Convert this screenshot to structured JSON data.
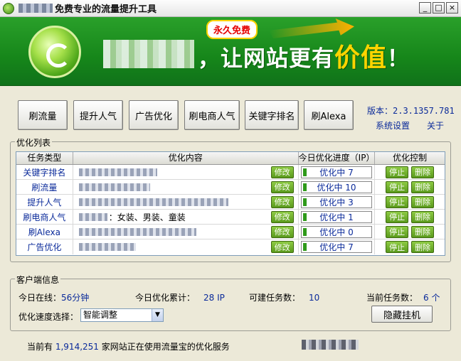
{
  "window": {
    "title": "免费专业的流量提升工具",
    "controls": {
      "minimize": "_",
      "maximize": "□",
      "close": "×"
    }
  },
  "banner": {
    "badge": "永久免费",
    "slogan_main": "，让网站更有",
    "slogan_accent": "价值",
    "slogan_end": "！"
  },
  "toolbar": {
    "buttons": [
      "刷流量",
      "提升人气",
      "广告优化",
      "刷电商人气",
      "关键字排名",
      "刷Alexa"
    ],
    "version": "版本：2.3.1357.781",
    "settings": "系统设置",
    "about": "关于"
  },
  "task_list": {
    "group_title": "优化列表",
    "headers": [
      "任务类型",
      "优化内容",
      "今日优化进度（IP）",
      "优化控制"
    ],
    "edit_label": "修改",
    "stop_label": "停止",
    "delete_label": "删除",
    "rows": [
      {
        "type": "关键字排名",
        "content": "",
        "status": "优化中",
        "ip": "7",
        "progress": 0.05
      },
      {
        "type": "刷流量",
        "content": "",
        "status": "优化中",
        "ip": "10",
        "progress": 0.05
      },
      {
        "type": "提升人气",
        "content": "",
        "status": "优化中",
        "ip": "3",
        "progress": 0.05
      },
      {
        "type": "刷电商人气",
        "content": "：女装、男装、童装",
        "status": "优化中",
        "ip": "1",
        "progress": 0.05
      },
      {
        "type": "刷Alexa",
        "content": "",
        "status": "优化中",
        "ip": "0",
        "progress": 0.05
      },
      {
        "type": "广告优化",
        "content": "",
        "status": "优化中",
        "ip": "7",
        "progress": 0.05
      }
    ]
  },
  "client_info": {
    "group_title": "客户端信息",
    "online_label": "今日在线：",
    "online_value": "56分钟",
    "total_label": "今日优化累计：",
    "total_value": "28 IP",
    "available_label": "可建任务数：",
    "available_value": "10",
    "current_label": "当前任务数：",
    "current_value": "6 个",
    "speed_label": "优化速度选择：",
    "speed_value": "智能调整",
    "hide_button": "隐藏挂机"
  },
  "footer": {
    "prefix": "当前有",
    "count": "1,914,251",
    "suffix": "家网站正在使用流量宝的优化服务"
  }
}
